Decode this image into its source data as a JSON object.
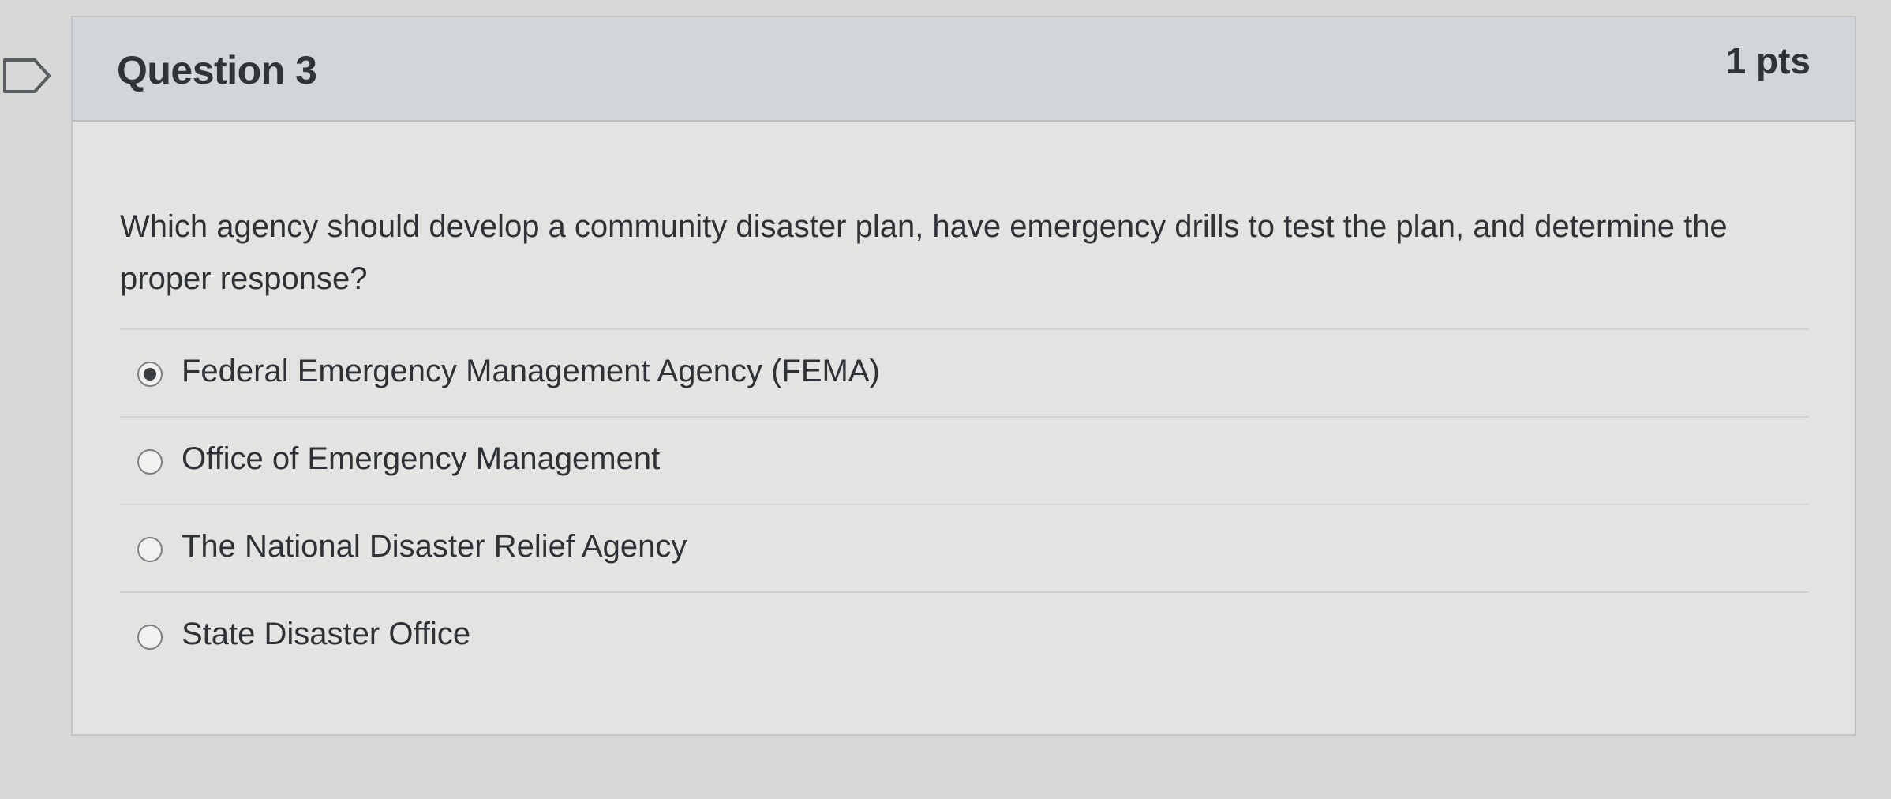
{
  "question": {
    "title": "Question 3",
    "points": "1 pts",
    "text": "Which agency should develop a community disaster plan, have emergency drills to test the plan, and determine the proper response?",
    "answers": [
      {
        "label": "Federal Emergency Management Agency (FEMA)",
        "selected": true
      },
      {
        "label": "Office of Emergency Management",
        "selected": false
      },
      {
        "label": "The National Disaster Relief Agency",
        "selected": false
      },
      {
        "label": "State Disaster Office",
        "selected": false
      }
    ]
  },
  "icons": {
    "flag": "flag-icon",
    "radio": "radio-button-icon"
  },
  "colors": {
    "header_bg": "#d2d6da",
    "card_bg": "#e3e4e2",
    "text": "#2e3236"
  }
}
